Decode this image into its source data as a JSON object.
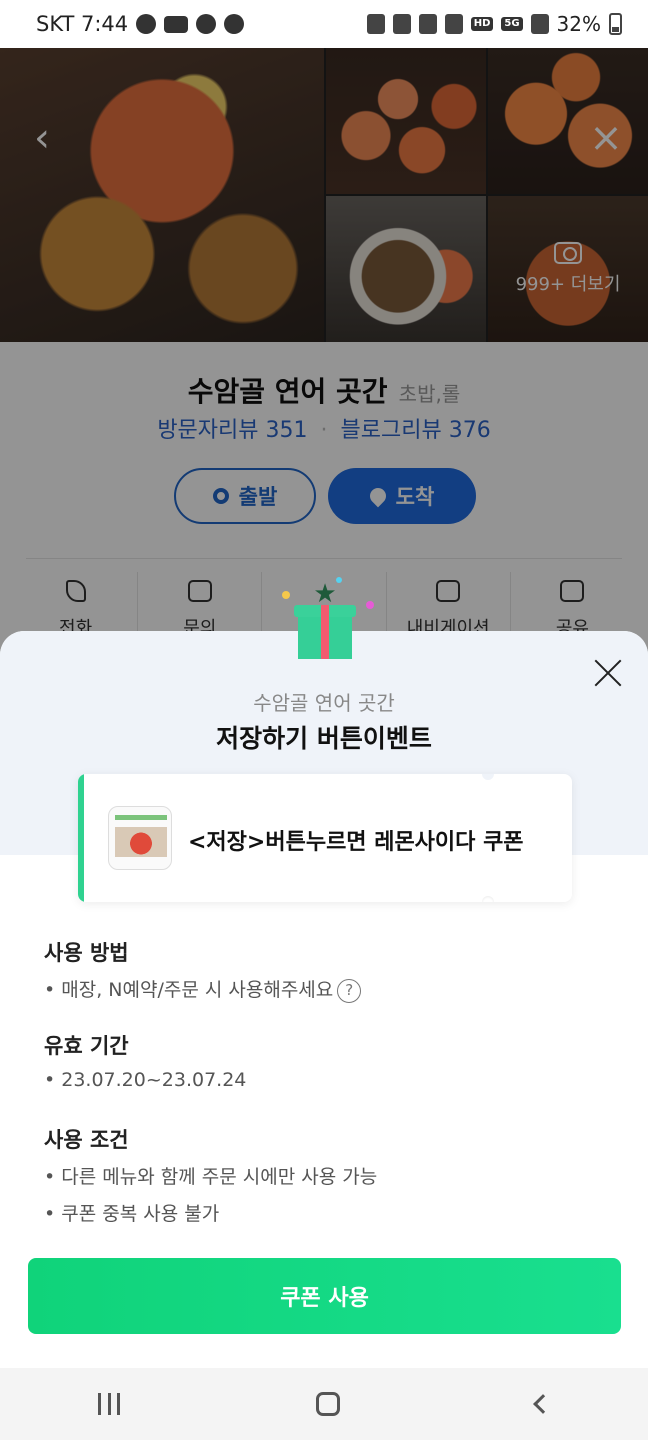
{
  "status_bar": {
    "carrier_time": "SKT 7:44",
    "battery": "32%",
    "network": "5G",
    "hd_voice": "HD"
  },
  "gallery": {
    "more_label": "999+ 더보기"
  },
  "place": {
    "name": "수암골 연어 곳간",
    "category": "초밥,롤",
    "visitor_reviews": "방문자리뷰 351",
    "blog_reviews": "블로그리뷰 376",
    "start_label": "출발",
    "end_label": "도착",
    "actions": [
      "전화",
      "문의",
      "",
      "내비게이션",
      "공유"
    ]
  },
  "sheet": {
    "subtitle": "수암골 연어 곳간",
    "title": "저장하기 버튼이벤트",
    "coupon_text": "<저장>버튼누르면 레몬사이다 쿠폰",
    "sections": [
      {
        "title": "사용 방법",
        "items": [
          "매장, N예약/주문 시 사용해주세요"
        ]
      },
      {
        "title": "유효 기간",
        "items": [
          "23.07.20~23.07.24"
        ]
      },
      {
        "title": "사용 조건",
        "items": [
          "다른 메뉴와 함께 주문 시에만 사용 가능",
          "쿠폰 중복 사용 불가"
        ]
      }
    ],
    "use_button": "쿠폰 사용",
    "accent_color": "#19d985"
  },
  "icons": [
    "back-icon",
    "close-icon",
    "camera-icon",
    "phone-icon",
    "message-icon",
    "navigation-icon",
    "share-icon",
    "gift-icon",
    "help-icon"
  ]
}
